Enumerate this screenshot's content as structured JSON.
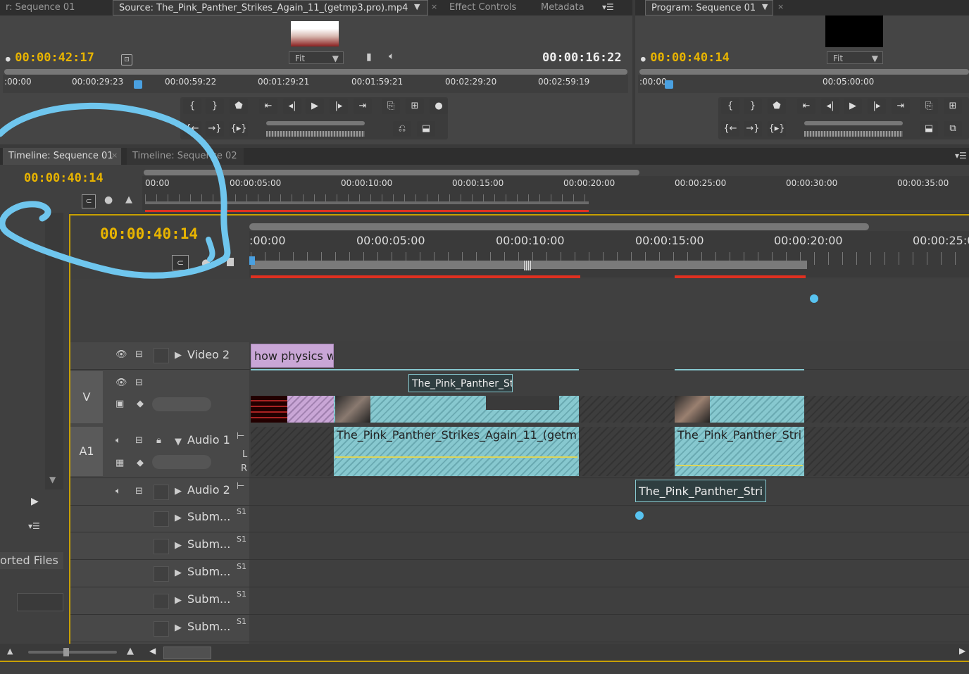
{
  "source_monitor": {
    "left_tab": "r: Sequence 01",
    "tab_source": "Source: The_Pink_Panther_Strikes_Again_11_(getmp3.pro).mp4",
    "tab_effects": "Effect Controls",
    "tab_metadata": "Metadata",
    "timecode_in": "00:00:42:17",
    "timecode_duration": "00:00:16:22",
    "fit_label": "Fit",
    "ruler": [
      ":00:00",
      "00:00:29:23",
      "00:00:59:22",
      "00:01:29:21",
      "00:01:59:21",
      "00:02:29:20",
      "00:02:59:19"
    ]
  },
  "program_monitor": {
    "tab": "Program: Sequence 01",
    "timecode": "00:00:40:14",
    "fit_label": "Fit",
    "ruler": [
      ":00:00",
      "00:05:00:00"
    ]
  },
  "timeline": {
    "tab_active": "Timeline: Sequence 01",
    "tab_other": "Timeline: Sequence 02",
    "timecode_small": "00:00:40:14",
    "timecode_large": "00:00:40:14",
    "ruler_top": [
      "00:00",
      "00:00:05:00",
      "00:00:10:00",
      "00:00:15:00",
      "00:00:20:00",
      "00:00:25:00",
      "00:00:30:00",
      "00:00:35:00"
    ],
    "ruler_main": [
      ":00:00",
      "00:00:05:00",
      "00:00:10:00",
      "00:00:15:00",
      "00:00:20:00",
      "00:00:25:0"
    ],
    "tracks": {
      "video2": "Video 2",
      "video1_label": "V",
      "audio1_label": "A1",
      "audio1": "Audio 1",
      "audio2": "Audio 2",
      "audio1_L": "L",
      "audio1_R": "R",
      "submix": [
        "Subm...",
        "Subm...",
        "Subm...",
        "Subm...",
        "Subm..."
      ],
      "submix_tag": "S1"
    },
    "clips": {
      "v2_title": "how physics w",
      "v1_label": "The_Pink_Panther_Stri",
      "a1_clip1": "The_Pink_Panther_Strikes_Again_11_(getm",
      "a1_clip2": "The_Pink_Panther_Stri",
      "a2_clip": "The_Pink_Panther_Stri"
    }
  },
  "project_panel": {
    "imported_files": "orted Files"
  },
  "annotation_color": "#6fc6ee",
  "accent_timecode": "#e8b400"
}
